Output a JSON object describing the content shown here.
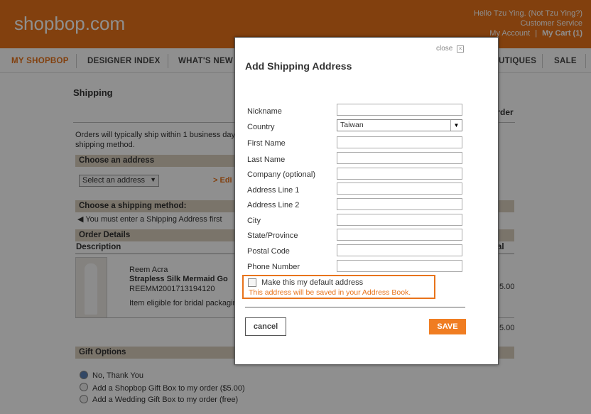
{
  "header": {
    "logo": "shopbop.com",
    "greeting": "Hello Tzu Ying. (Not Tzu Ying?)",
    "customer_service": "Customer Service",
    "my_account": "My Account",
    "separator": "|",
    "my_cart": "My Cart",
    "cart_count": "(1)"
  },
  "nav": {
    "my_shopbop": "MY SHOPBOP",
    "designer_index": "DESIGNER INDEX",
    "whats_new": "WHAT'S NEW",
    "boutiques": "UTIQUES",
    "sale": "SALE"
  },
  "shipping": {
    "title": "Shipping",
    "order_partial": "Order",
    "info_line1": "Orders will typically ship within 1 business day",
    "info_line2": "shipping method.",
    "choose_address": "Choose an address",
    "select_address": "Select an address",
    "edit_link": "> Edi",
    "choose_method": "Choose a shipping method:",
    "must_enter": "You must enter a Shipping Address first",
    "order_details": "Order Details",
    "description": "Description",
    "total_partial": "al",
    "designer": "Reem Acra",
    "product": "Strapless Silk Mermaid Go",
    "sku": "REEMM2001713194120",
    "eligible": "Item eligible for bridal packagin",
    "price1": "5.00",
    "price2": "5.00",
    "gift_options": "Gift Options",
    "gift_no": "No, Thank You",
    "gift_box": "Add a Shopbop Gift Box to my order ($5.00)",
    "gift_wedding": "Add a Wedding Gift Box to my order (free)"
  },
  "modal": {
    "close": "close",
    "title": "Add Shipping Address",
    "labels": {
      "nickname": "Nickname",
      "country": "Country",
      "first_name": "First Name",
      "last_name": "Last Name",
      "company": "Company (optional)",
      "address1": "Address Line 1",
      "address2": "Address Line 2",
      "city": "City",
      "state": "State/Province",
      "postal": "Postal Code",
      "phone": "Phone Number"
    },
    "country_value": "Taiwan",
    "default_address": "Make this my default address",
    "saved_note": "This address will be saved in your Address Book.",
    "cancel": "cancel",
    "save": "SAVE"
  },
  "colors": {
    "brand_orange": "#e8731a",
    "bar_tan": "#d9cfbe"
  }
}
